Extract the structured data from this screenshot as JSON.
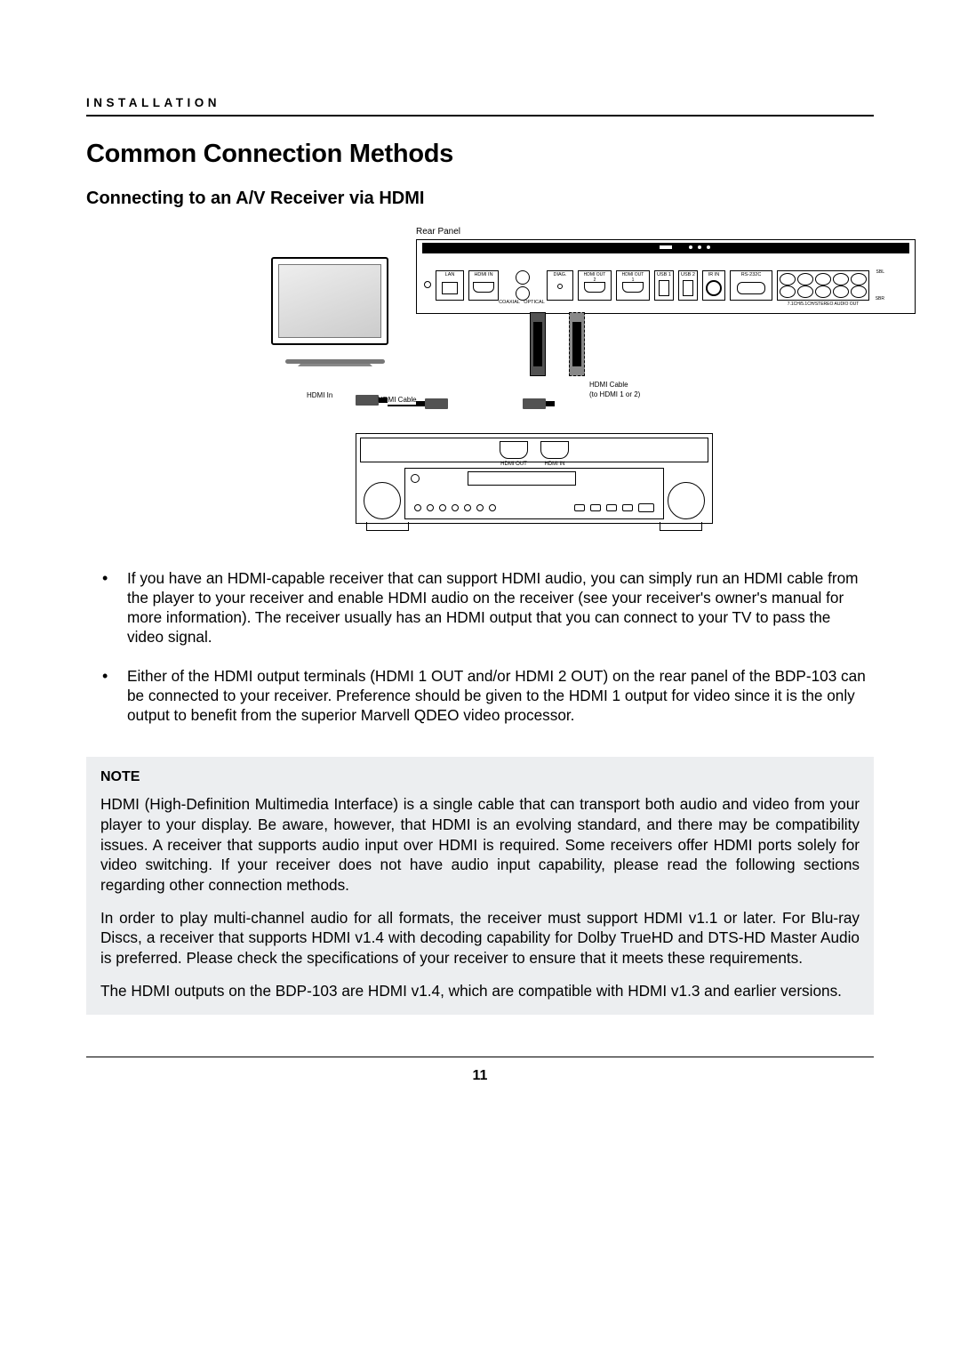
{
  "header": {
    "section": "INSTALLATION"
  },
  "title": "Common Connection Methods",
  "subtitle": "Connecting to an A/V Receiver via HDMI",
  "diagram": {
    "rear_panel_label": "Rear Panel",
    "tv_port": "HDMI In",
    "cable_a": "HDMI Cable",
    "cable_b_line1": "HDMI Cable",
    "cable_b_line2": "(to HDMI 1 or 2)",
    "receiver_ports": {
      "out": "HDMI OUT",
      "in": "HDMI IN"
    },
    "rear_ports": {
      "lan": "LAN",
      "hdmi_in": "HDMI IN",
      "diag": "DIAG.",
      "hdmi_out2": "HDMI OUT 2",
      "hdmi_out1": "HDMI OUT 1",
      "usb1": "USB 1",
      "usb2": "USB 2",
      "ir": "IR IN",
      "rs232": "RS-232C",
      "coax": "COAXIAL",
      "opt": "OPTICAL",
      "audio_caption": "7.1CH/5.1CH/STEREO AUDIO OUT",
      "audio_top": [
        "SBL",
        "",
        "",
        "",
        ""
      ],
      "audio_bot": [
        "",
        "",
        "",
        "",
        "SBR"
      ]
    }
  },
  "bullets": [
    "If you have an HDMI-capable receiver that can support HDMI audio, you can simply run an HDMI cable from the player to your receiver and enable HDMI audio on the receiver (see your receiver's owner's manual for more information). The receiver usually has an HDMI output that you can connect to your TV to pass the video signal.",
    "Either of the HDMI output terminals (HDMI 1 OUT and/or HDMI 2 OUT) on the rear panel of the BDP-103 can be connected to your receiver. Preference should be given to the HDMI 1 output for video since it is the only output to benefit from the superior Marvell QDEO video processor."
  ],
  "note": {
    "title": "NOTE",
    "paras": [
      "HDMI (High-Definition Multimedia Interface) is a single cable that can transport both audio and video from your player to your display. Be aware, however, that HDMI is an evolving standard, and there may be compatibility issues. A receiver that supports audio input over HDMI is required. Some receivers offer HDMI ports solely for video switching. If your receiver does not have audio input capability, please read the following sections regarding other connection methods.",
      "In order to play multi-channel audio for all formats, the receiver must support HDMI v1.1 or later. For Blu-ray Discs, a receiver that supports HDMI v1.4 with decoding capability for Dolby TrueHD and DTS-HD Master Audio is preferred. Please check the specifications of your receiver to ensure that it meets these requirements.",
      "The HDMI outputs on the BDP-103 are HDMI v1.4, which are compatible with HDMI v1.3 and earlier versions."
    ]
  },
  "page_number": "11"
}
